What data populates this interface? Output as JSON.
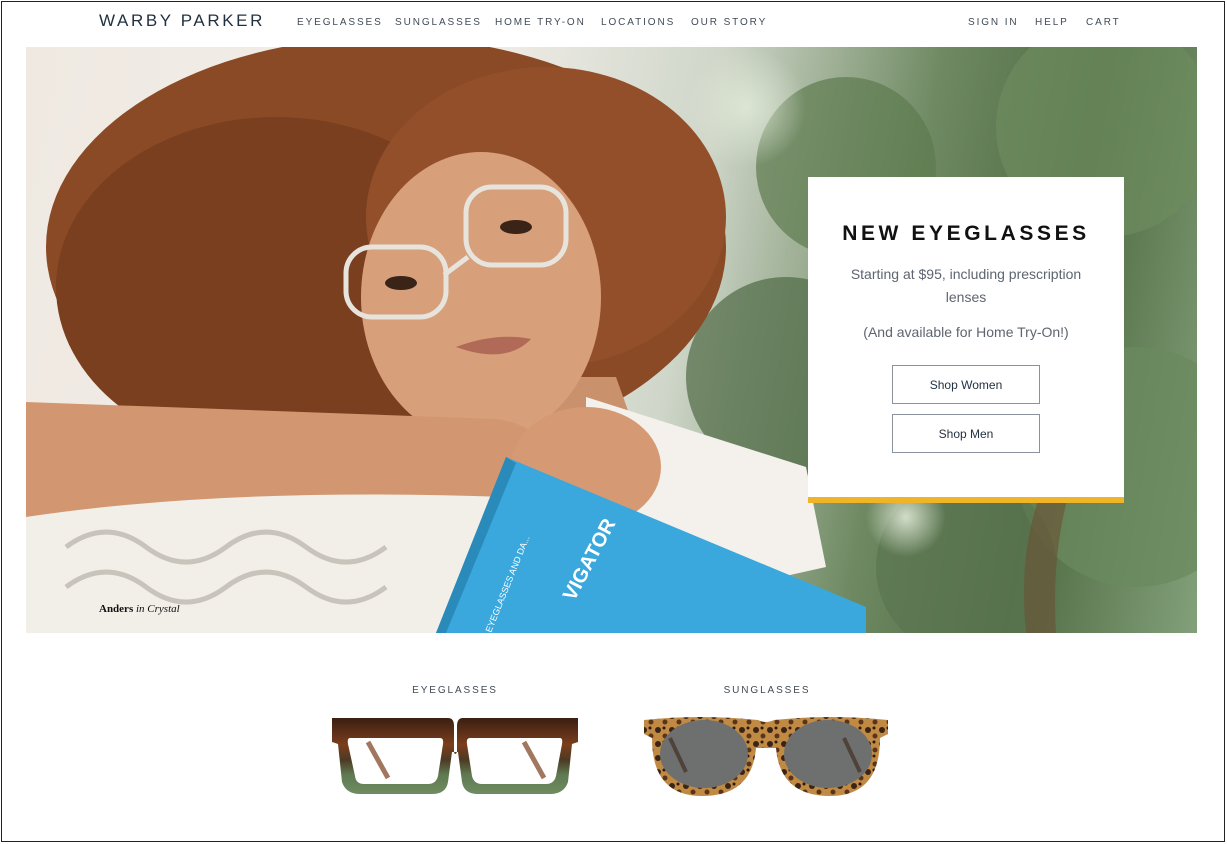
{
  "header": {
    "logo": "WARBY PARKER",
    "nav_left": [
      "EYEGLASSES",
      "SUNGLASSES",
      "HOME TRY-ON",
      "LOCATIONS",
      "OUR STORY"
    ],
    "nav_right": [
      "SIGN IN",
      "HELP",
      "CART"
    ]
  },
  "hero": {
    "caption_name": "Anders",
    "caption_in": "in",
    "caption_color": "Crystal",
    "book_text": "VIGATOR",
    "book_spine": "EYEGLASSES AND DA...",
    "card": {
      "title": "NEW EYEGLASSES",
      "subtitle": "Starting at $95, including prescription lenses",
      "note": "(And available for Home Try-On!)",
      "shop_women": "Shop Women",
      "shop_men": "Shop Men",
      "accent_color": "#f0b428"
    }
  },
  "categories": [
    {
      "label": "EYEGLASSES",
      "icon": "tortoise-eyeglasses-icon"
    },
    {
      "label": "SUNGLASSES",
      "icon": "tortoise-sunglasses-icon"
    }
  ],
  "colors": {
    "text_dark": "#233241",
    "book_blue": "#3aa8dc"
  }
}
